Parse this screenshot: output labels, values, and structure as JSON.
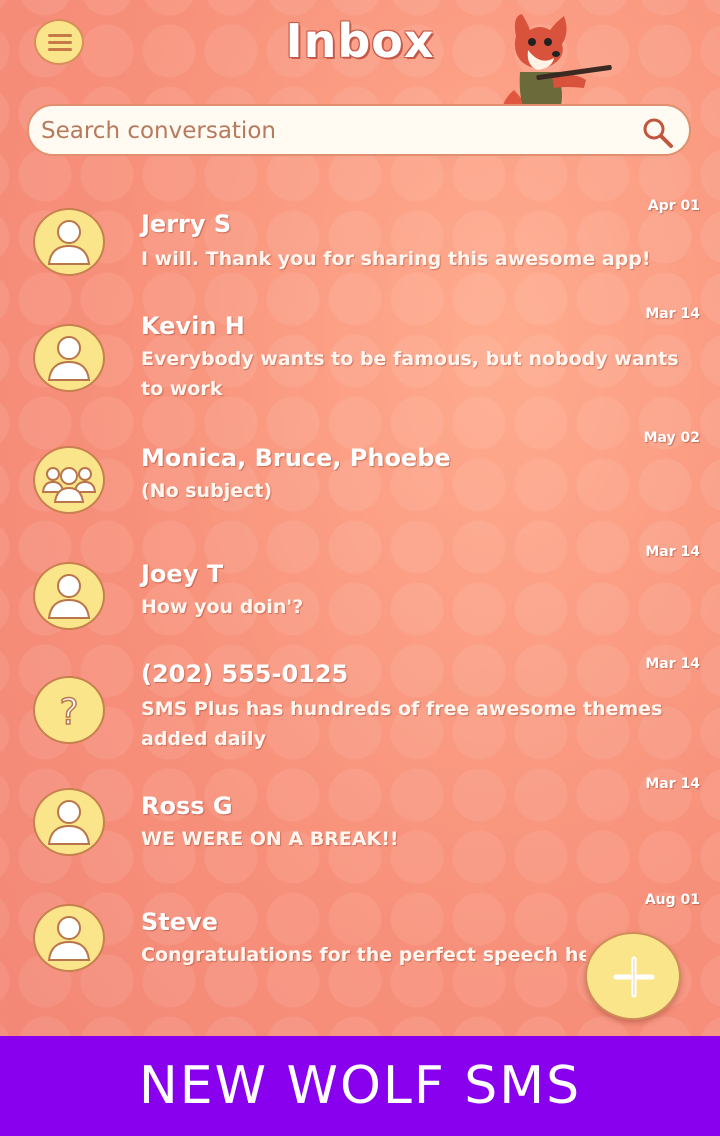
{
  "header": {
    "title": "Inbox",
    "menu_icon": "hamburger-menu-icon",
    "mascot": "fox-playing-flute-illustration"
  },
  "search": {
    "placeholder": "Search conversation",
    "icon": "search-icon"
  },
  "conversations": [
    {
      "name": "Jerry S",
      "snippet": "I will. Thank you for sharing this awesome app!",
      "date": "Apr 01",
      "avatar": "person-icon"
    },
    {
      "name": "Kevin H",
      "snippet": "Everybody wants to be famous, but nobody wants to work",
      "date": "Mar 14",
      "avatar": "person-icon"
    },
    {
      "name": "Monica, Bruce, Phoebe",
      "snippet": "(No subject)",
      "date": "May 02",
      "avatar": "group-icon"
    },
    {
      "name": "Joey T",
      "snippet": "How you doin'?",
      "date": "Mar 14",
      "avatar": "person-icon"
    },
    {
      "name": "(202) 555-0125",
      "snippet": "SMS Plus has hundreds of free awesome themes added daily",
      "date": "Mar 14",
      "avatar": "unknown-contact-icon"
    },
    {
      "name": "Ross G",
      "snippet": "WE WERE ON A BREAK!!",
      "date": "Mar 14",
      "avatar": "person-icon"
    },
    {
      "name": "Steve",
      "snippet": "Congratulations for the perfect speech held t",
      "date": "Aug 01",
      "avatar": "person-icon"
    }
  ],
  "fab": {
    "icon": "plus-icon"
  },
  "banner": {
    "text": "NEW WOLF SMS"
  },
  "colors": {
    "background": "#f7907a",
    "avatar_fill": "#fbe58a",
    "banner": "#8800ee"
  }
}
